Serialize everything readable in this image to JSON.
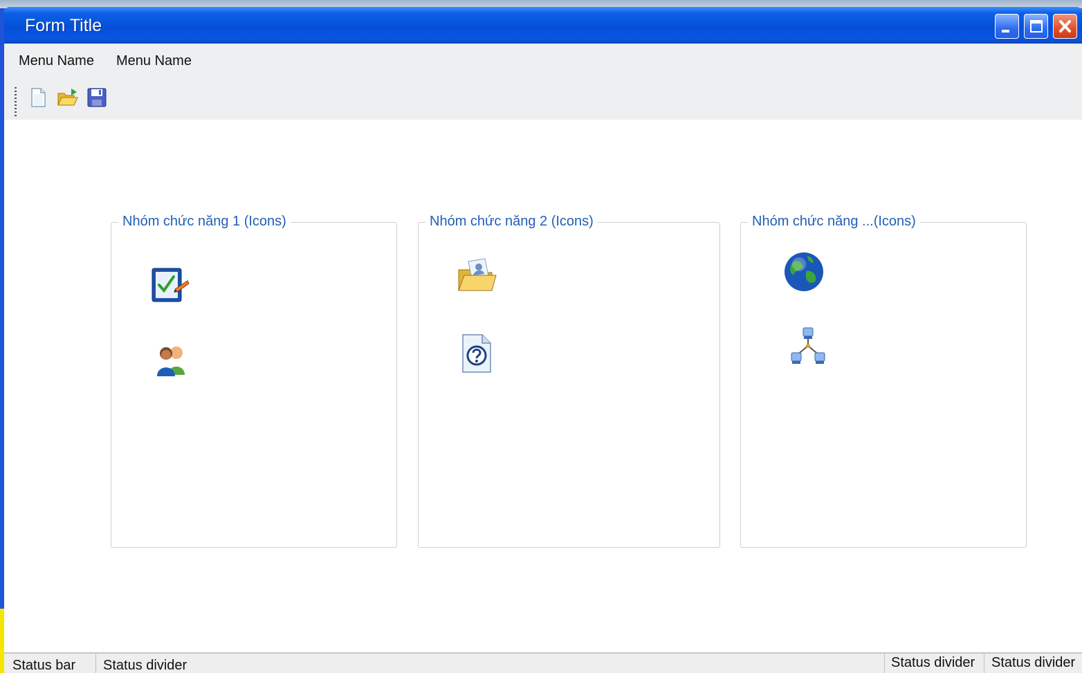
{
  "window": {
    "title": "Form Title"
  },
  "titlebar_buttons": [
    "minimize",
    "maximize",
    "close"
  ],
  "menu": [
    {
      "label": "Menu Name"
    },
    {
      "label": "Menu Name"
    }
  ],
  "toolbar": {
    "icons": [
      "new-file-icon",
      "open-folder-icon",
      "save-icon"
    ]
  },
  "groups": [
    {
      "title": "Nhóm chức năng 1 (Icons)",
      "icons": [
        "checklist-edit-icon",
        "users-icon"
      ]
    },
    {
      "title": "Nhóm chức năng 2 (Icons)",
      "icons": [
        "contact-folder-icon",
        "help-document-icon"
      ]
    },
    {
      "title": "Nhóm chức năng ...(Icons)",
      "icons": [
        "globe-icon",
        "network-icon"
      ]
    }
  ],
  "statusbar": [
    "Status bar",
    "Status divider",
    "Status divider",
    "Status divider"
  ],
  "colors": {
    "titlebar": "#0550d8",
    "group_title": "#1f5fb8",
    "close_button": "#e0502a"
  }
}
